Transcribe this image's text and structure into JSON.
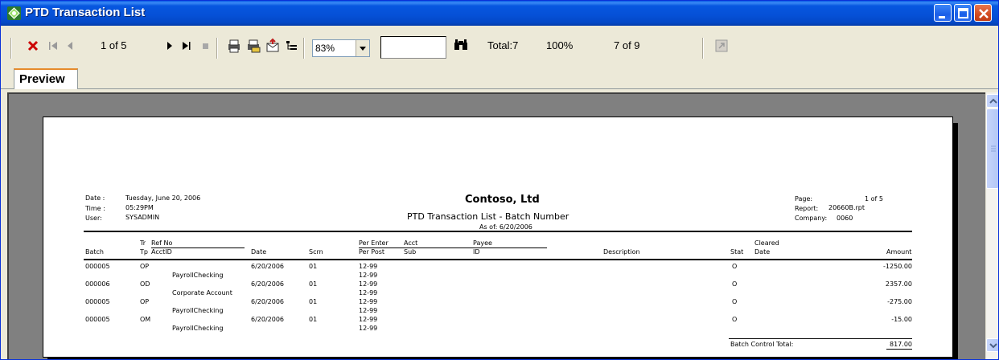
{
  "window": {
    "title": "PTD Transaction List"
  },
  "toolbar": {
    "page_indicator": "1 of 5",
    "zoom": "83%",
    "total": "Total:7",
    "percent": "100%",
    "records": "7 of 9"
  },
  "tab": {
    "label": "Preview"
  },
  "report": {
    "header": {
      "date_label": "Date :",
      "date_value": "Tuesday, June 20, 2006",
      "time_label": "Time :",
      "time_value": "05:29PM",
      "user_label": "User:",
      "user_value": "SYSADMIN",
      "company": "Contoso, Ltd",
      "title": "PTD Transaction List - Batch Number",
      "as_of": "As of: 6/20/2006",
      "page_label": "Page:",
      "page_value": "1 of 5",
      "report_label": "Report:",
      "report_value": "20660B.rpt",
      "company_label": "Company:",
      "company_value": "0060"
    },
    "columns": {
      "batch": "Batch",
      "tr": "Tr",
      "tp": "Tp",
      "ref_no": "Ref No",
      "acct_id": "AcctID",
      "date": "Date",
      "scrn": "Scrn",
      "per_enter": "Per Enter",
      "per_post": "Per Post",
      "acct": "Acct",
      "sub": "Sub",
      "payee": "Payee",
      "id": "ID",
      "description": "Description",
      "stat": "Stat",
      "cleared": "Cleared",
      "cleared_date": "Date",
      "amount": "Amount"
    },
    "rows": [
      {
        "batch": "000005",
        "trtp": "OP",
        "acct": "PayrollChecking",
        "date": "6/20/2006",
        "scrn": "01",
        "per_enter": "12-99",
        "per_post": "12-99",
        "stat": "O",
        "amount": "-1250.00"
      },
      {
        "batch": "000006",
        "trtp": "OD",
        "acct": "Corporate Account",
        "date": "6/20/2006",
        "scrn": "01",
        "per_enter": "12-99",
        "per_post": "12-99",
        "stat": "O",
        "amount": "2357.00"
      },
      {
        "batch": "000005",
        "trtp": "OP",
        "acct": "PayrollChecking",
        "date": "6/20/2006",
        "scrn": "01",
        "per_enter": "12-99",
        "per_post": "12-99",
        "stat": "O",
        "amount": "-275.00"
      },
      {
        "batch": "000005",
        "trtp": "OM",
        "acct": "PayrollChecking",
        "date": "6/20/2006",
        "scrn": "01",
        "per_enter": "12-99",
        "per_post": "12-99",
        "stat": "O",
        "amount": "-15.00"
      }
    ],
    "batch_total_label": "Batch Control Total:",
    "batch_total_value": "817.00"
  },
  "icons": {
    "app": "crystal-reports-icon",
    "close_report": "close-x-icon",
    "first": "first-page-icon",
    "prev": "prev-page-icon",
    "next": "next-page-icon",
    "last": "last-page-icon",
    "stop": "stop-icon",
    "print": "print-icon",
    "print_setup": "print-setup-icon",
    "export": "export-icon",
    "group_tree": "group-tree-icon",
    "search": "binoculars-icon",
    "drill": "drill-icon"
  },
  "colors": {
    "title_bar": "#0550d6",
    "close_x": "#cc0000",
    "tab_accent": "#e68b2c"
  }
}
